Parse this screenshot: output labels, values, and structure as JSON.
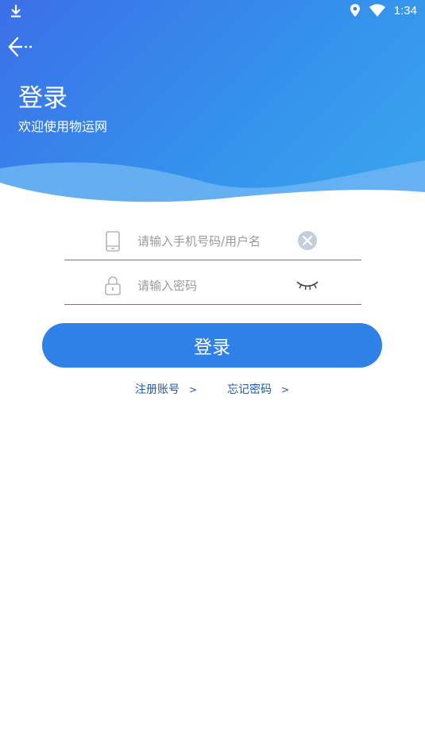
{
  "status_bar": {
    "time": "1:34"
  },
  "header": {
    "title": "登录",
    "subtitle": "欢迎使用物运网"
  },
  "form": {
    "username": {
      "placeholder": "请输入手机号码/用户名",
      "value": ""
    },
    "password": {
      "placeholder": "请输入密码",
      "value": ""
    },
    "login_label": "登录"
  },
  "links": {
    "register": "注册账号",
    "forgot": "忘记密码",
    "arrow": ">"
  },
  "colors": {
    "header_start": "#3b6fe8",
    "header_end": "#3aa6ee",
    "accent": "#2f80e7",
    "link": "#1f58a8"
  },
  "icons": [
    "download-icon",
    "location-icon",
    "wifi-icon",
    "back-arrow-icon",
    "phone-icon",
    "clear-icon",
    "lock-icon",
    "eye-closed-icon"
  ]
}
